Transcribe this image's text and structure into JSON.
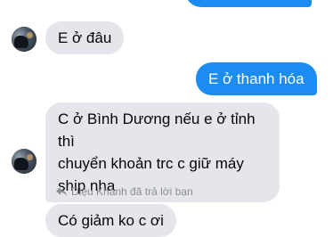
{
  "messages": [
    {
      "id": "m_out_top",
      "direction": "outgoing",
      "text": ""
    },
    {
      "id": "m1",
      "direction": "incoming",
      "text": "E ở đâu"
    },
    {
      "id": "m2",
      "direction": "outgoing",
      "text": "E ở thanh hóa"
    },
    {
      "id": "m3",
      "direction": "incoming",
      "lines": [
        "C ở Bình Dương nếu e ở tỉnh thì",
        "chuyển khoản trc c giữ máy",
        "ship nha"
      ]
    },
    {
      "id": "m4",
      "direction": "incoming",
      "text": "Có giảm ko c ơi"
    }
  ],
  "reply_note": {
    "text": "Diệu Khánh đã trả lời bạn",
    "icon": "reply-arrow-icon"
  },
  "colors": {
    "outgoing_bubble": "#1a8cf2",
    "incoming_bubble": "#e4e6eb",
    "meta_text": "#8a8d91"
  }
}
